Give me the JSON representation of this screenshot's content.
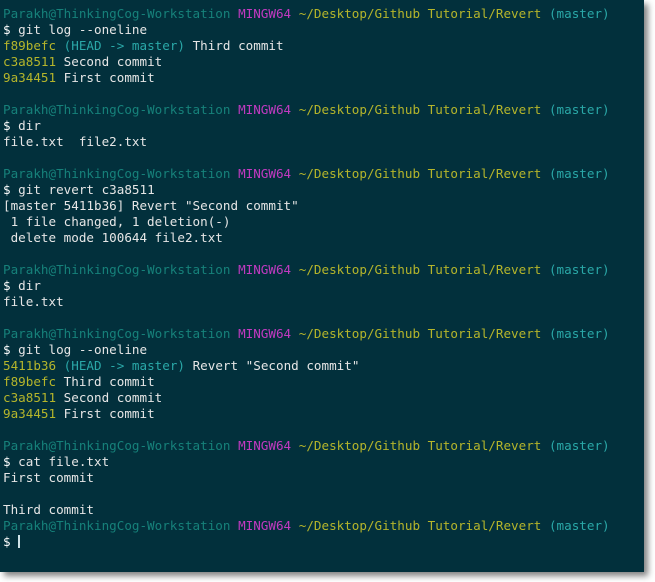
{
  "window": {
    "background_color": "#02303c",
    "shadow_color": "#8a8a8a"
  },
  "colors": {
    "user": "#16817a",
    "mingw": "#c13ac1",
    "path": "#b5b52b",
    "branch": "#2aa8a8",
    "hash": "#b5b52b",
    "ref": "#2aa8a8",
    "text": "#e6e6e6",
    "prompt": "#ffffff"
  },
  "prompt": {
    "user_host": "Parakh@ThinkingCog-Workstation",
    "shell": "MINGW64",
    "path": "~/Desktop/Github Tutorial/Revert",
    "branch": "(master)",
    "sigil": "$"
  },
  "session": {
    "blocks": [
      {
        "command": "git log --oneline",
        "output": [
          {
            "hash": "f89befc",
            "ref": "(HEAD -> master)",
            "message": "Third commit"
          },
          {
            "hash": "c3a8511",
            "ref": "",
            "message": "Second commit"
          },
          {
            "hash": "9a34451",
            "ref": "",
            "message": "First commit"
          }
        ]
      },
      {
        "command": "dir",
        "output": [
          {
            "hash": "",
            "ref": "",
            "message": "file.txt  file2.txt"
          }
        ]
      },
      {
        "command": "git revert c3a8511",
        "output": [
          {
            "hash": "",
            "ref": "",
            "message": "[master 5411b36] Revert \"Second commit\""
          },
          {
            "hash": "",
            "ref": "",
            "message": " 1 file changed, 1 deletion(-)"
          },
          {
            "hash": "",
            "ref": "",
            "message": " delete mode 100644 file2.txt"
          }
        ]
      },
      {
        "command": "dir",
        "output": [
          {
            "hash": "",
            "ref": "",
            "message": "file.txt"
          }
        ]
      },
      {
        "command": "git log --oneline",
        "output": [
          {
            "hash": "5411b36",
            "ref": "(HEAD -> master)",
            "message": "Revert \"Second commit\""
          },
          {
            "hash": "f89befc",
            "ref": "",
            "message": "Third commit"
          },
          {
            "hash": "c3a8511",
            "ref": "",
            "message": "Second commit"
          },
          {
            "hash": "9a34451",
            "ref": "",
            "message": "First commit"
          }
        ]
      },
      {
        "command": "cat file.txt",
        "output": [
          {
            "hash": "",
            "ref": "",
            "message": "First commit"
          },
          {
            "hash": "",
            "ref": "",
            "message": ""
          },
          {
            "hash": "",
            "ref": "",
            "message": "Third commit"
          }
        ]
      }
    ],
    "final_prompt_has_cursor": true
  },
  "lines": [
    {
      "t": "prompt"
    },
    {
      "t": "cmd",
      "v": "git log --oneline"
    },
    {
      "t": "log",
      "hash": "f89befc",
      "ref": "(HEAD -> master)",
      "msg": "Third commit"
    },
    {
      "t": "log",
      "hash": "c3a8511",
      "ref": "",
      "msg": "Second commit"
    },
    {
      "t": "log",
      "hash": "9a34451",
      "ref": "",
      "msg": "First commit"
    },
    {
      "t": "blank"
    },
    {
      "t": "prompt"
    },
    {
      "t": "cmd",
      "v": "dir"
    },
    {
      "t": "out",
      "v": "file.txt  file2.txt"
    },
    {
      "t": "blank"
    },
    {
      "t": "prompt"
    },
    {
      "t": "cmd",
      "v": "git revert c3a8511"
    },
    {
      "t": "out",
      "v": "[master 5411b36] Revert \"Second commit\""
    },
    {
      "t": "out",
      "v": " 1 file changed, 1 deletion(-)"
    },
    {
      "t": "out",
      "v": " delete mode 100644 file2.txt"
    },
    {
      "t": "blank"
    },
    {
      "t": "prompt"
    },
    {
      "t": "cmd",
      "v": "dir"
    },
    {
      "t": "out",
      "v": "file.txt"
    },
    {
      "t": "blank"
    },
    {
      "t": "prompt"
    },
    {
      "t": "cmd",
      "v": "git log --oneline"
    },
    {
      "t": "log",
      "hash": "5411b36",
      "ref": "(HEAD -> master)",
      "msg": "Revert \"Second commit\""
    },
    {
      "t": "log",
      "hash": "f89befc",
      "ref": "",
      "msg": "Third commit"
    },
    {
      "t": "log",
      "hash": "c3a8511",
      "ref": "",
      "msg": "Second commit"
    },
    {
      "t": "log",
      "hash": "9a34451",
      "ref": "",
      "msg": "First commit"
    },
    {
      "t": "blank"
    },
    {
      "t": "prompt"
    },
    {
      "t": "cmd",
      "v": "cat file.txt"
    },
    {
      "t": "out",
      "v": "First commit"
    },
    {
      "t": "blank"
    },
    {
      "t": "out",
      "v": "Third commit"
    },
    {
      "t": "prompt"
    },
    {
      "t": "cursor"
    }
  ]
}
